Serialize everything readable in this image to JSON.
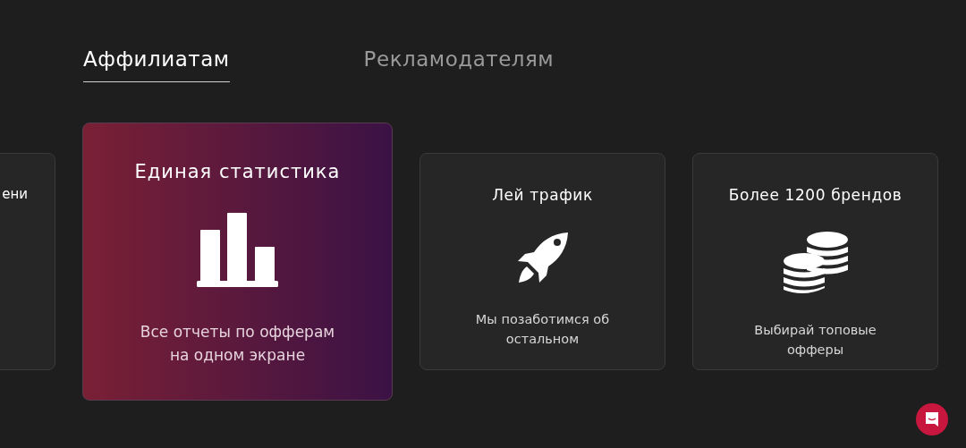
{
  "tabs": [
    {
      "label": "Аффилиатам",
      "selected": true
    },
    {
      "label": "Рекламодателям",
      "selected": false
    }
  ],
  "cards": [
    {
      "title": "ени",
      "selected": false
    },
    {
      "title": "Единая статистика",
      "text": "Все отчеты по офферам на одном экране",
      "selected": true
    },
    {
      "title": "Лей трафик",
      "text": "Мы позаботимся об остальном",
      "selected": false
    },
    {
      "title": "Более 1200 брендов",
      "text": "Выбирай топовые офферы",
      "selected": false
    }
  ]
}
